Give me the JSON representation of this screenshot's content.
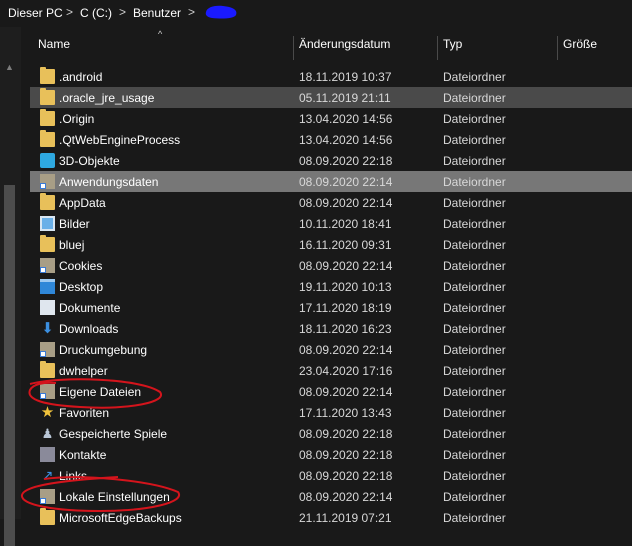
{
  "breadcrumb": {
    "items": [
      "Dieser PC",
      "C (C:)",
      "Benutzer"
    ],
    "separator": ">"
  },
  "columns": {
    "name": "Name",
    "date": "Änderungsdatum",
    "type": "Typ",
    "size": "Größe"
  },
  "files": [
    {
      "name": ".android",
      "date": "18.11.2019 10:37",
      "type": "Dateiordner",
      "icon": "folder-icon"
    },
    {
      "name": ".oracle_jre_usage",
      "date": "05.11.2019 21:11",
      "type": "Dateiordner",
      "icon": "folder-icon"
    },
    {
      "name": ".Origin",
      "date": "13.04.2020 14:56",
      "type": "Dateiordner",
      "icon": "folder-icon"
    },
    {
      "name": ".QtWebEngineProcess",
      "date": "13.04.2020 14:56",
      "type": "Dateiordner",
      "icon": "folder-icon"
    },
    {
      "name": "3D-Objekte",
      "date": "08.09.2020 22:18",
      "type": "Dateiordner",
      "icon": "3d-objects-icon"
    },
    {
      "name": "Anwendungsdaten",
      "date": "08.09.2020 22:14",
      "type": "Dateiordner",
      "icon": "folder-shortcut-icon"
    },
    {
      "name": "AppData",
      "date": "08.09.2020 22:14",
      "type": "Dateiordner",
      "icon": "folder-icon"
    },
    {
      "name": "Bilder",
      "date": "10.11.2020 18:41",
      "type": "Dateiordner",
      "icon": "pictures-icon"
    },
    {
      "name": "bluej",
      "date": "16.11.2020 09:31",
      "type": "Dateiordner",
      "icon": "folder-icon"
    },
    {
      "name": "Cookies",
      "date": "08.09.2020 22:14",
      "type": "Dateiordner",
      "icon": "folder-shortcut-icon"
    },
    {
      "name": "Desktop",
      "date": "19.11.2020 10:13",
      "type": "Dateiordner",
      "icon": "desktop-icon"
    },
    {
      "name": "Dokumente",
      "date": "17.11.2020 18:19",
      "type": "Dateiordner",
      "icon": "documents-icon"
    },
    {
      "name": "Downloads",
      "date": "18.11.2020 16:23",
      "type": "Dateiordner",
      "icon": "downloads-icon"
    },
    {
      "name": "Druckumgebung",
      "date": "08.09.2020 22:14",
      "type": "Dateiordner",
      "icon": "folder-shortcut-icon"
    },
    {
      "name": "dwhelper",
      "date": "23.04.2020 17:16",
      "type": "Dateiordner",
      "icon": "folder-icon"
    },
    {
      "name": "Eigene Dateien",
      "date": "08.09.2020 22:14",
      "type": "Dateiordner",
      "icon": "folder-shortcut-icon"
    },
    {
      "name": "Favoriten",
      "date": "17.11.2020 13:43",
      "type": "Dateiordner",
      "icon": "favorites-icon"
    },
    {
      "name": "Gespeicherte Spiele",
      "date": "08.09.2020 22:18",
      "type": "Dateiordner",
      "icon": "saved-games-icon"
    },
    {
      "name": "Kontakte",
      "date": "08.09.2020 22:18",
      "type": "Dateiordner",
      "icon": "contacts-icon"
    },
    {
      "name": "Links",
      "date": "08.09.2020 22:18",
      "type": "Dateiordner",
      "icon": "links-icon"
    },
    {
      "name": "Lokale Einstellungen",
      "date": "08.09.2020 22:14",
      "type": "Dateiordner",
      "icon": "folder-shortcut-icon"
    },
    {
      "name": "MicrosoftEdgeBackups",
      "date": "21.11.2019 07:21",
      "type": "Dateiordner",
      "icon": "folder-icon"
    }
  ],
  "colors": {
    "background": "#191919",
    "selected_row": "#777777",
    "highlight_row": "#4a4a4a",
    "annotation": "#d4141c",
    "redaction": "#1a1aff"
  }
}
